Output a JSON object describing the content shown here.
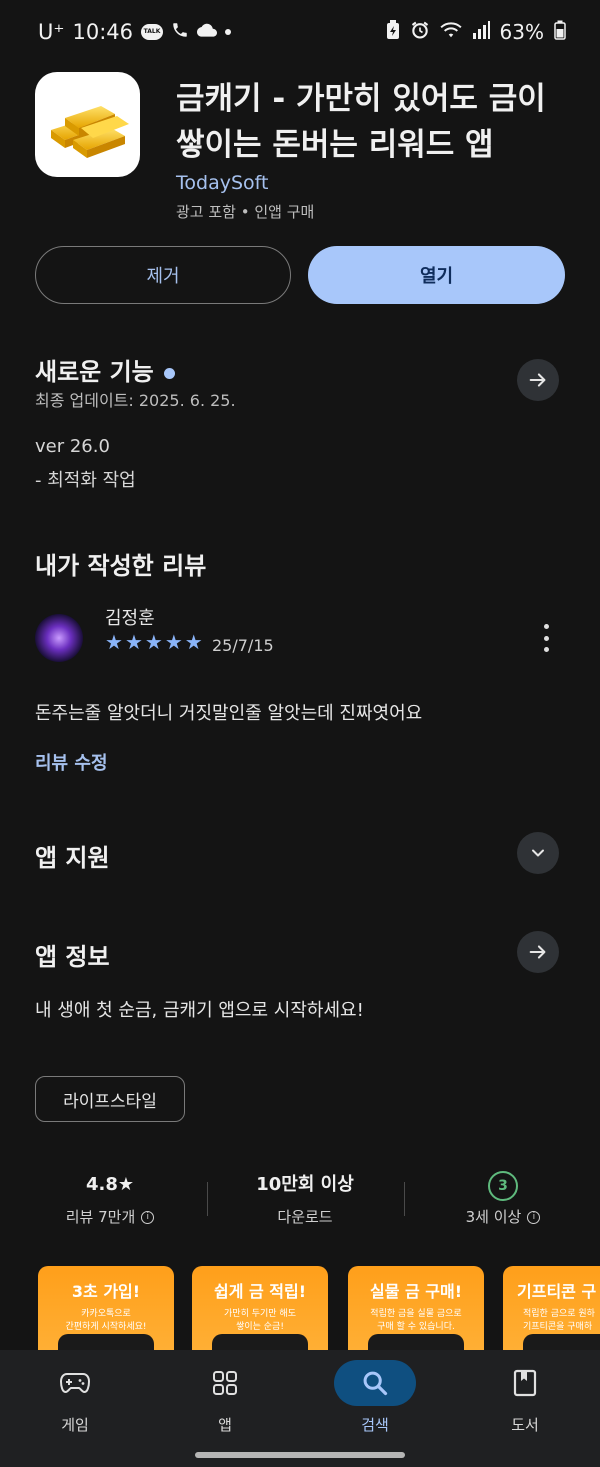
{
  "status_bar": {
    "carrier": "U⁺",
    "time": "10:46",
    "talk_badge": "TALK",
    "battery": "63%"
  },
  "app": {
    "title": "금캐기 - 가만히 있어도 금이 쌓이는 돈버는 리워드 앱",
    "developer": "TodaySoft",
    "meta": "광고 포함 • 인앱 구매",
    "remove_label": "제거",
    "open_label": "열기"
  },
  "whats_new": {
    "title": "새로운 기능",
    "last_updated": "최종 업데이트: 2025. 6. 25.",
    "version": "ver 26.0",
    "notes": "- 최적화 작업"
  },
  "my_review": {
    "title": "내가 작성한 리뷰",
    "author": "김정훈",
    "rating": 5,
    "date": "25/7/15",
    "text": "돈주는줄 알앗더니 거짓말인줄 알앗는데 진짜엿어요",
    "edit_label": "리뷰 수정"
  },
  "app_support": {
    "title": "앱 지원"
  },
  "app_info": {
    "title": "앱 정보",
    "description": "내 생애 첫 순금, 금캐기 앱으로 시작하세요!",
    "category_chip": "라이프스타일"
  },
  "stats": {
    "rating_value": "4.8★",
    "rating_label": "리뷰 7만개",
    "downloads_value": "10만회 이상",
    "downloads_label": "다운로드",
    "age_badge": "3",
    "age_label": "3세 이상"
  },
  "screenshots": [
    {
      "headline": "3초 가입!",
      "sub": "카카오톡으로\n간편하게 시작하세요!"
    },
    {
      "headline": "쉽게 금 적립!",
      "sub": "가만히 두기만 해도\n쌓이는 순금!"
    },
    {
      "headline": "실물 금 구매!",
      "sub": "적립한 금을 실물 금으로\n구매 할 수 있습니다."
    },
    {
      "headline": "기프티콘 구",
      "sub": "적립한 금으로 원하\n기프티콘을 구매하"
    }
  ],
  "bottom_nav": [
    {
      "label": "게임",
      "icon": "gamepad-icon",
      "active": false
    },
    {
      "label": "앱",
      "icon": "apps-grid-icon",
      "active": false
    },
    {
      "label": "검색",
      "icon": "search-icon",
      "active": true
    },
    {
      "label": "도서",
      "icon": "book-icon",
      "active": false
    }
  ],
  "colors": {
    "background": "#141414",
    "accent": "#a8c7fa",
    "link": "#a6c1ee",
    "nav_active": "#0f4f80",
    "age_green": "#5fba7d"
  }
}
